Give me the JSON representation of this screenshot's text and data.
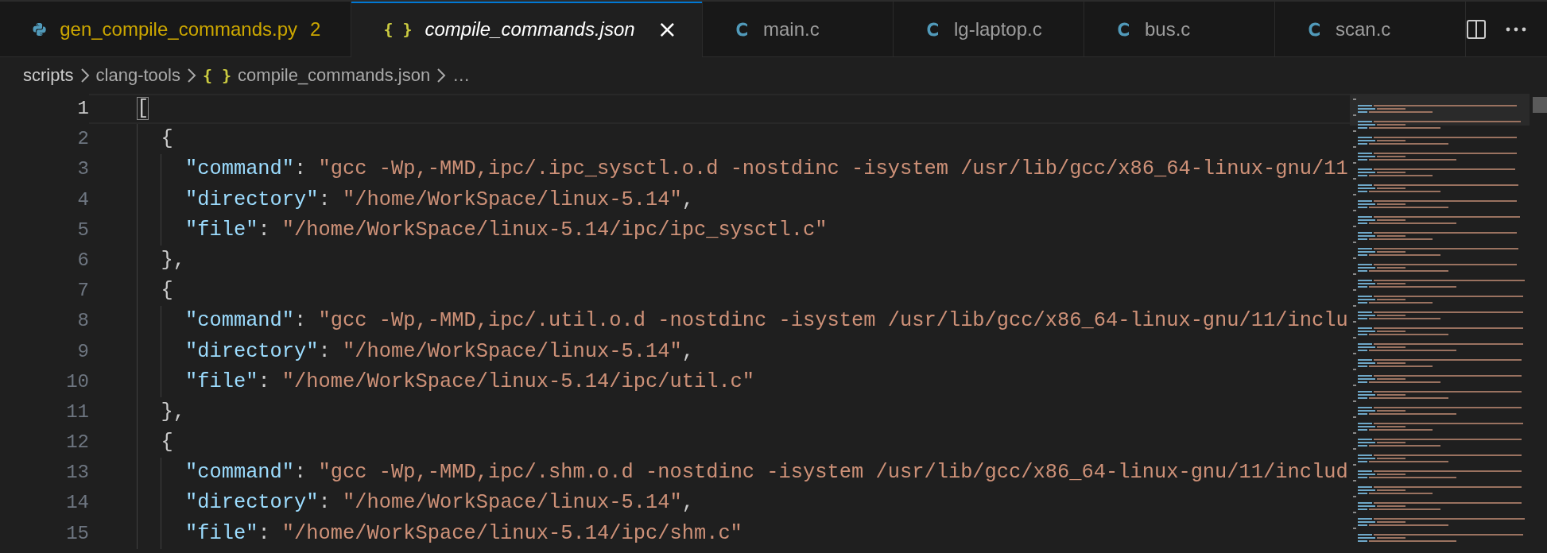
{
  "tabs": [
    {
      "label": "gen_compile_commands.py",
      "kind": "python",
      "selected": false,
      "preview": false,
      "problems": "2"
    },
    {
      "label": "compile_commands.json",
      "kind": "json",
      "glyph": "{ }",
      "selected": true,
      "preview": true,
      "close": "×"
    },
    {
      "label": "main.c",
      "kind": "c",
      "selected": false,
      "preview": false
    },
    {
      "label": "lg-laptop.c",
      "kind": "c",
      "selected": false,
      "preview": false
    },
    {
      "label": "bus.c",
      "kind": "c",
      "selected": false,
      "preview": false
    },
    {
      "label": "scan.c",
      "kind": "c",
      "selected": false,
      "preview": false
    }
  ],
  "breadcrumb": [
    {
      "label": "scripts"
    },
    {
      "label": "clang-tools"
    },
    {
      "label": "compile_commands.json",
      "kind": "json",
      "glyph": "{ }"
    },
    {
      "label": "…"
    }
  ],
  "editor": {
    "lines": [
      {
        "number": "1",
        "current": true,
        "tokens": [
          {
            "kind": "bracket-match",
            "text": "["
          }
        ]
      },
      {
        "number": "2",
        "current": false,
        "tokens": [
          {
            "kind": "punct",
            "text": "  {"
          }
        ]
      },
      {
        "number": "3",
        "current": false,
        "tokens": [
          {
            "kind": "key",
            "text": "    \"command\""
          },
          {
            "kind": "punct",
            "text": ": "
          },
          {
            "kind": "string",
            "text": "\"gcc -Wp,-MMD,ipc/.ipc_sysctl.o.d -nostdinc -isystem /usr/lib/gcc/x86_64-linux-gnu/11"
          }
        ]
      },
      {
        "number": "4",
        "current": false,
        "tokens": [
          {
            "kind": "key",
            "text": "    \"directory\""
          },
          {
            "kind": "punct",
            "text": ": "
          },
          {
            "kind": "string",
            "text": "\"/home/WorkSpace/linux-5.14\""
          },
          {
            "kind": "punct",
            "text": ","
          }
        ]
      },
      {
        "number": "5",
        "current": false,
        "tokens": [
          {
            "kind": "key",
            "text": "    \"file\""
          },
          {
            "kind": "punct",
            "text": ": "
          },
          {
            "kind": "string",
            "text": "\"/home/WorkSpace/linux-5.14/ipc/ipc_sysctl.c\""
          }
        ]
      },
      {
        "number": "6",
        "current": false,
        "tokens": [
          {
            "kind": "punct",
            "text": "  },"
          }
        ]
      },
      {
        "number": "7",
        "current": false,
        "tokens": [
          {
            "kind": "punct",
            "text": "  {"
          }
        ]
      },
      {
        "number": "8",
        "current": false,
        "tokens": [
          {
            "kind": "key",
            "text": "    \"command\""
          },
          {
            "kind": "punct",
            "text": ": "
          },
          {
            "kind": "string",
            "text": "\"gcc -Wp,-MMD,ipc/.util.o.d -nostdinc -isystem /usr/lib/gcc/x86_64-linux-gnu/11/inclu"
          }
        ]
      },
      {
        "number": "9",
        "current": false,
        "tokens": [
          {
            "kind": "key",
            "text": "    \"directory\""
          },
          {
            "kind": "punct",
            "text": ": "
          },
          {
            "kind": "string",
            "text": "\"/home/WorkSpace/linux-5.14\""
          },
          {
            "kind": "punct",
            "text": ","
          }
        ]
      },
      {
        "number": "10",
        "current": false,
        "tokens": [
          {
            "kind": "key",
            "text": "    \"file\""
          },
          {
            "kind": "punct",
            "text": ": "
          },
          {
            "kind": "string",
            "text": "\"/home/WorkSpace/linux-5.14/ipc/util.c\""
          }
        ]
      },
      {
        "number": "11",
        "current": false,
        "tokens": [
          {
            "kind": "punct",
            "text": "  },"
          }
        ]
      },
      {
        "number": "12",
        "current": false,
        "tokens": [
          {
            "kind": "punct",
            "text": "  {"
          }
        ]
      },
      {
        "number": "13",
        "current": false,
        "tokens": [
          {
            "kind": "key",
            "text": "    \"command\""
          },
          {
            "kind": "punct",
            "text": ": "
          },
          {
            "kind": "string",
            "text": "\"gcc -Wp,-MMD,ipc/.shm.o.d -nostdinc -isystem /usr/lib/gcc/x86_64-linux-gnu/11/includ"
          }
        ]
      },
      {
        "number": "14",
        "current": false,
        "tokens": [
          {
            "kind": "key",
            "text": "    \"directory\""
          },
          {
            "kind": "punct",
            "text": ": "
          },
          {
            "kind": "string",
            "text": "\"/home/WorkSpace/linux-5.14\""
          },
          {
            "kind": "punct",
            "text": ","
          }
        ]
      },
      {
        "number": "15",
        "current": false,
        "tokens": [
          {
            "kind": "key",
            "text": "    \"file\""
          },
          {
            "kind": "punct",
            "text": ": "
          },
          {
            "kind": "string",
            "text": "\"/home/WorkSpace/linux-5.14/ipc/shm.c\""
          }
        ]
      }
    ]
  }
}
